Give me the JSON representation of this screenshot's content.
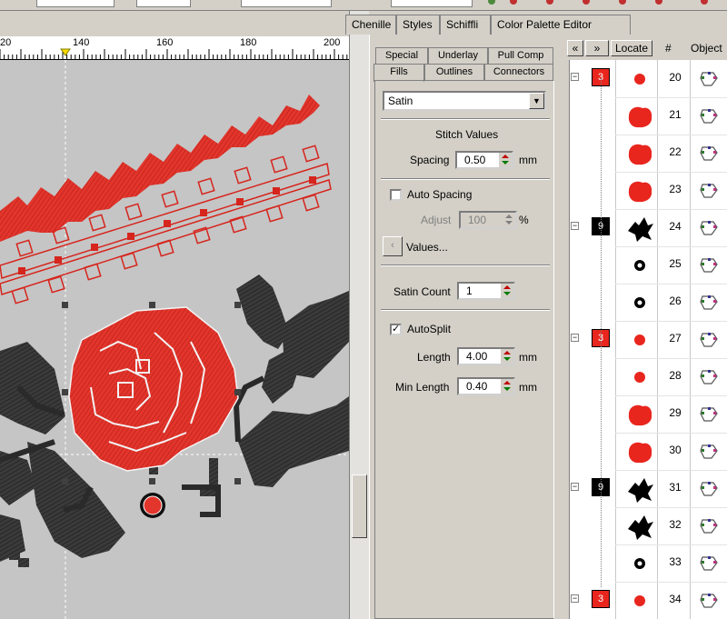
{
  "ruler": {
    "ticks": [
      "20",
      "140",
      "160",
      "180",
      "200"
    ]
  },
  "top_tabs": [
    "Chenille",
    "Styles",
    "Schiffli",
    "Color Palette Editor"
  ],
  "prop_tabs": {
    "row1": [
      "Special",
      "Underlay",
      "Pull Comp"
    ],
    "row2": [
      "Fills",
      "Outlines",
      "Connectors"
    ]
  },
  "fill": {
    "type": "Satin",
    "stitch_values_title": "Stitch Values",
    "spacing_label": "Spacing",
    "spacing_value": "0.50",
    "spacing_unit": "mm",
    "auto_spacing_label": "Auto Spacing",
    "auto_spacing_checked": false,
    "adjust_label": "Adjust",
    "adjust_value": "100",
    "adjust_unit": "%",
    "values_button": "Values...",
    "values_arrow": "‹",
    "satin_count_label": "Satin Count",
    "satin_count_value": "1",
    "autosplit_label": "AutoSplit",
    "autosplit_checked": true,
    "autosplit_mark": "✓",
    "length_label": "Length",
    "length_value": "4.00",
    "length_unit": "mm",
    "min_length_label": "Min Length",
    "min_length_value": "0.40",
    "min_length_unit": "mm"
  },
  "sequence": {
    "collapse_label": "«",
    "expand_label": "»",
    "locate_label": "Locate",
    "num_header": "#",
    "object_header": "Object",
    "colors": {
      "red": "#e8261e",
      "black": "#000000"
    },
    "rows": [
      {
        "num": "20",
        "group": "3",
        "group_color": "red",
        "shape": "small-red"
      },
      {
        "num": "21",
        "shape": "big-red"
      },
      {
        "num": "22",
        "shape": "big-red"
      },
      {
        "num": "23",
        "shape": "big-red"
      },
      {
        "num": "24",
        "group": "9",
        "group_color": "black",
        "shape": "leaf-black"
      },
      {
        "num": "25",
        "shape": "ring-black"
      },
      {
        "num": "26",
        "shape": "ring-black"
      },
      {
        "num": "27",
        "group": "3",
        "group_color": "red",
        "shape": "small-red"
      },
      {
        "num": "28",
        "shape": "small-red"
      },
      {
        "num": "29",
        "shape": "big-red"
      },
      {
        "num": "30",
        "shape": "big-red"
      },
      {
        "num": "31",
        "group": "9",
        "group_color": "black",
        "shape": "leaf-black"
      },
      {
        "num": "32",
        "shape": "leaf-black"
      },
      {
        "num": "33",
        "shape": "ring-black"
      },
      {
        "num": "34",
        "group": "3",
        "group_color": "red",
        "shape": "small-red"
      }
    ]
  }
}
